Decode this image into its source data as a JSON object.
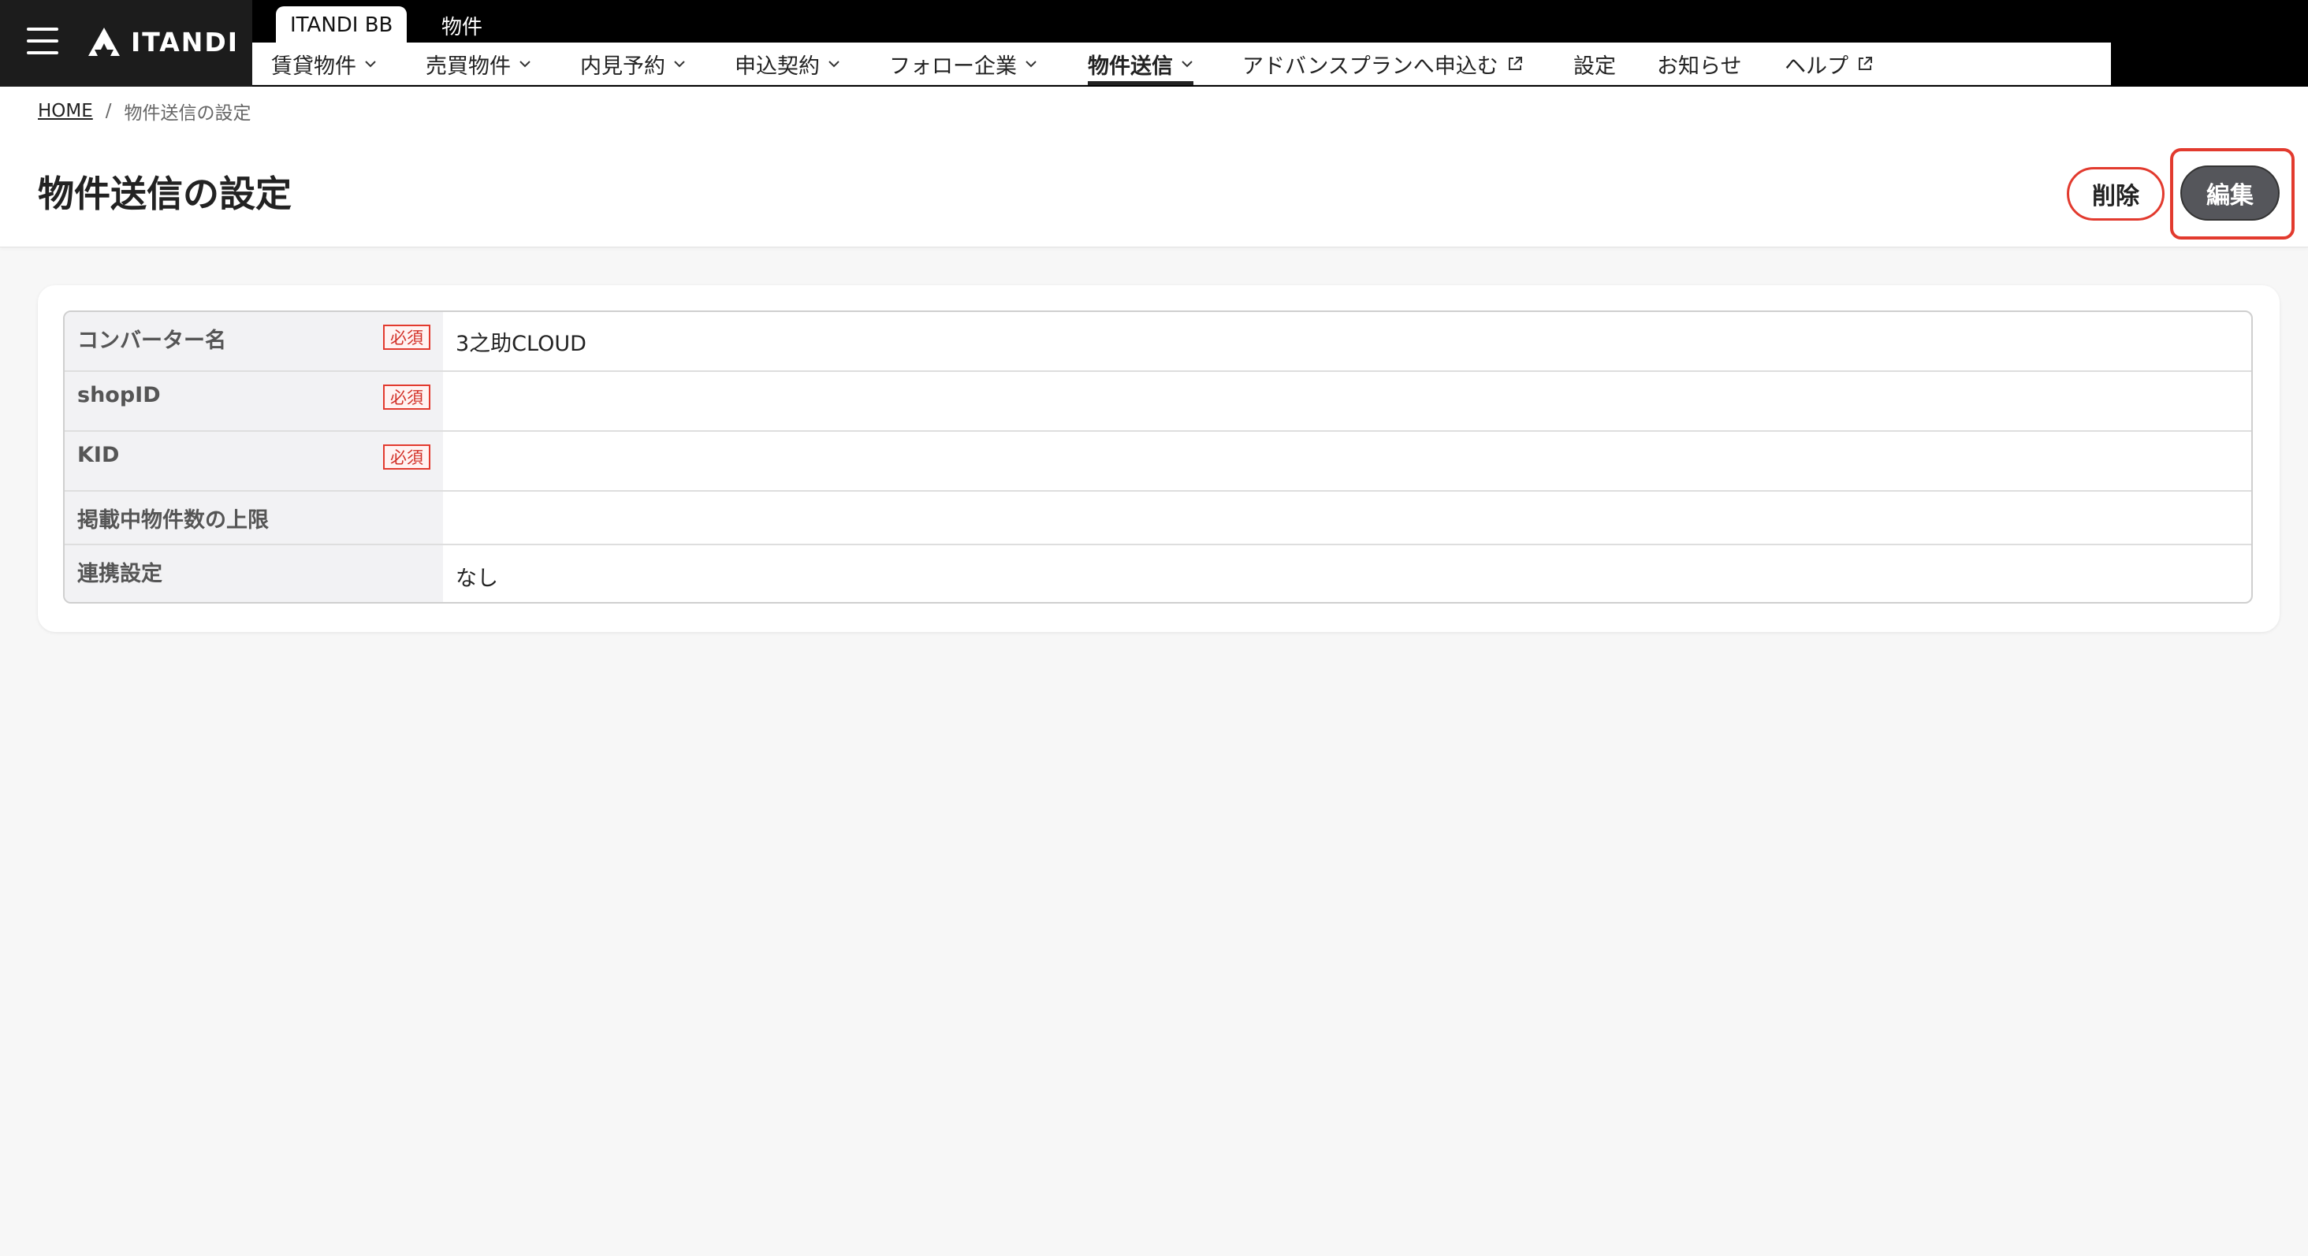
{
  "header": {
    "brand": "ITANDI",
    "product_tabs": [
      {
        "label": "ITANDI BB"
      },
      {
        "label": "物件"
      }
    ],
    "nav": [
      {
        "label": "賃貸物件"
      },
      {
        "label": "売買物件"
      },
      {
        "label": "内見予約"
      },
      {
        "label": "申込契約"
      },
      {
        "label": "フォロー企業"
      },
      {
        "label": "物件送信"
      },
      {
        "label": "アドバンスプランへ申込む"
      },
      {
        "label": "設定"
      },
      {
        "label": "お知らせ"
      },
      {
        "label": "ヘルプ"
      }
    ],
    "active_nav": "物件送信"
  },
  "breadcrumb": {
    "home": "HOME",
    "separator": "/",
    "current": "物件送信の設定"
  },
  "page": {
    "title": "物件送信の設定",
    "delete_label": "削除",
    "edit_label": "編集"
  },
  "settings": {
    "required_badge": "必須",
    "rows": [
      {
        "label": "コンバーター名",
        "required": true,
        "value": "3之助CLOUD"
      },
      {
        "label": "shopID",
        "required": true,
        "value": ""
      },
      {
        "label": "KID",
        "required": true,
        "value": ""
      },
      {
        "label": "掲載中物件数の上限",
        "required": false,
        "value": ""
      },
      {
        "label": "連携設定",
        "required": false,
        "value": "なし"
      }
    ]
  },
  "colors": {
    "accent_red": "#e23a2e",
    "topbar": "#000000",
    "edit_button": "#55565b"
  }
}
